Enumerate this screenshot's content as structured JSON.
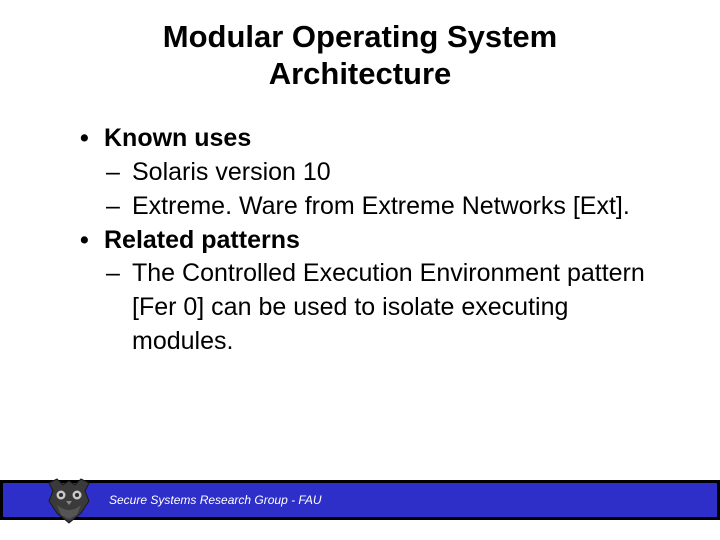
{
  "title_line1": "Modular Operating System",
  "title_line2": "Architecture",
  "bullets": {
    "b1": "Known uses",
    "b1a": "Solaris version 10",
    "b1b": "Extreme. Ware from Extreme Networks [Ext].",
    "b2": "Related patterns",
    "b2a": "The Controlled Execution Environment pattern [Fer 0] can be used to isolate executing modules."
  },
  "footer": "Secure Systems Research Group - FAU"
}
